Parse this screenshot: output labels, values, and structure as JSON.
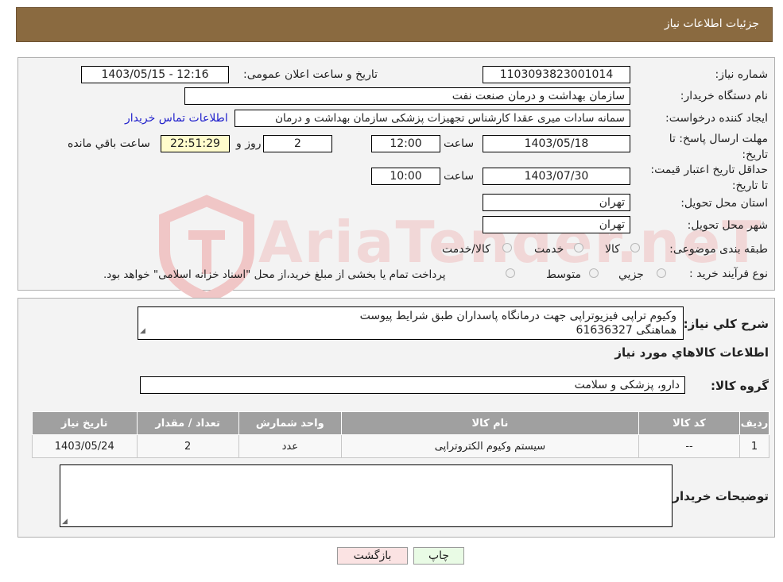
{
  "header": {
    "title": "جزئیات اطلاعات نیاز"
  },
  "watermark": {
    "text": "AriaTender.neT"
  },
  "form": {
    "need_number_label": "شماره نیاز:",
    "need_number": "1103093823001014",
    "announce_label": "تاریخ و ساعت اعلان عمومی:",
    "announce_value": "1403/05/15 - 12:16",
    "buyer_org_label": "نام دستگاه خریدار:",
    "buyer_org": "سازمان بهداشت و درمان صنعت نفت",
    "creator_label": "ایجاد کننده درخواست:",
    "creator": "سمانه سادات میری عقدا کارشناس تجهیزات پزشکی سازمان بهداشت و درمان",
    "contact_link": "اطلاعات تماس خریدار",
    "deadline_label": "مهلت ارسال پاسخ: تا تاریخ:",
    "deadline_date": "1403/05/18",
    "time_label": "ساعت",
    "deadline_time": "12:00",
    "days_value": "2",
    "days_label": "روز و",
    "remaining_time": "22:51:29",
    "remaining_label": "ساعت باقي مانده",
    "validity_label": "حداقل تاریخ اعتبار قیمت: تا تاریخ:",
    "validity_date": "1403/07/30",
    "validity_time": "10:00",
    "province_label": "استان محل تحویل:",
    "province": "تهران",
    "city_label": "شهر محل تحویل:",
    "city": "تهران",
    "category_label": "طبقه بندی موضوعی:",
    "category_options": [
      "کالا",
      "خدمت",
      "کالا/خدمت"
    ],
    "process_label": "نوع فرآیند خرید :",
    "process_options": [
      "جزیي",
      "متوسط"
    ],
    "process_note": "پرداخت تمام یا بخشی از مبلغ خرید،از محل \"اسناد خزانه اسلامی\" خواهد بود."
  },
  "description": {
    "label": "شرح كلي نياز:",
    "line1": "وکیوم تراپی فیزیوتراپی جهت درمانگاه پاسداران طبق شرایط پیوست",
    "line2": "هماهنگی 61636327"
  },
  "goods": {
    "section_title": "اطلاعات كالاهاي مورد نياز",
    "group_label": "گروه کالا:",
    "group_value": "دارو، پزشکی و سلامت",
    "columns": [
      "ردیف",
      "کد کالا",
      "نام کالا",
      "واحد شمارش",
      "تعداد / مقدار",
      "تاریخ نیاز"
    ],
    "rows": [
      {
        "index": "1",
        "code": "--",
        "name": "سیستم وکیوم الکتروتراپی",
        "unit": "عدد",
        "qty": "2",
        "date": "1403/05/24"
      }
    ],
    "buyer_notes_label": "توضیحات خریدار:"
  },
  "buttons": {
    "print": "چاپ",
    "back": "بازگشت"
  }
}
